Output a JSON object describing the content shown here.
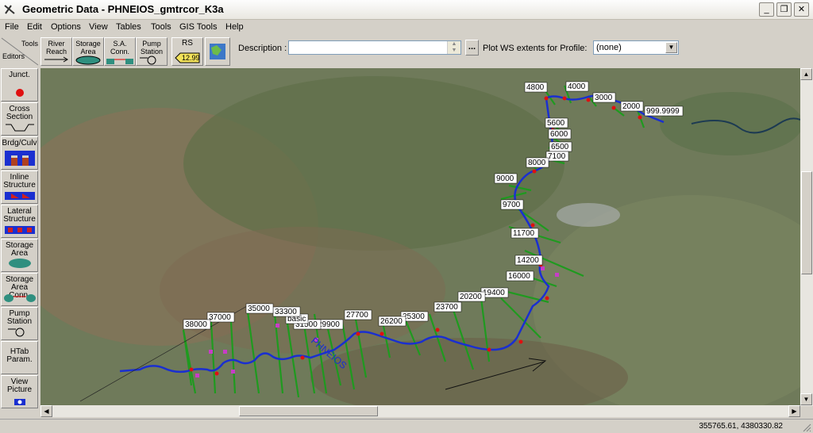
{
  "window": {
    "title": "Geometric Data - PHNEIOS_gmtrcor_K3a",
    "minimize": "_",
    "restore": "❐",
    "close": "✕"
  },
  "menu": [
    "File",
    "Edit",
    "Options",
    "View",
    "Tables",
    "Tools",
    "GIS Tools",
    "Help"
  ],
  "toolbar": {
    "tools_label": "Tools",
    "editors_label": "Editors",
    "river_reach": "River Reach",
    "storage_area": "Storage Area",
    "sa_conn": "S.A. Conn.",
    "pump_station": "Pump Station",
    "rs_label": "RS",
    "rs_value": "12.99",
    "description_label": "Description :",
    "description_value": "",
    "browse_label": "...",
    "plot_ws_label": "Plot WS extents for Profile:",
    "profile_value": "(none)"
  },
  "editors": [
    {
      "id": "junct",
      "label": "Junct."
    },
    {
      "id": "cross-section",
      "label": "Cross Section"
    },
    {
      "id": "brdg-culv",
      "label": "Brdg/Culv"
    },
    {
      "id": "inline-structure",
      "label": "Inline Structure"
    },
    {
      "id": "lateral-structure",
      "label": "Lateral Structure"
    },
    {
      "id": "storage-area",
      "label": "Storage Area"
    },
    {
      "id": "storage-area-conn",
      "label": "Storage Area Conn."
    },
    {
      "id": "pump-station",
      "label": "Pump Station"
    },
    {
      "id": "htab-param",
      "label": "HTab Param."
    },
    {
      "id": "view-picture",
      "label": "View Picture"
    }
  ],
  "map": {
    "river_name": "PHNEIOS",
    "stations": [
      "4800",
      "4000",
      "3000",
      "2000",
      "999.9999",
      "5600",
      "6000",
      "6500",
      "7100",
      "8000",
      "9000",
      "9700",
      "11700",
      "14200",
      "16000",
      "19400",
      "20200",
      "23700",
      "25300",
      "26200",
      "27700",
      "29900",
      "31500",
      "basic",
      "33300",
      "35000",
      "37000",
      "38000"
    ],
    "colors": {
      "river": "#1a2fd0",
      "xs": "#1f9a1f",
      "node": "#e01010",
      "levee": "#c83cc8"
    }
  },
  "status": {
    "coords": "355765.61, 4380330.82"
  }
}
